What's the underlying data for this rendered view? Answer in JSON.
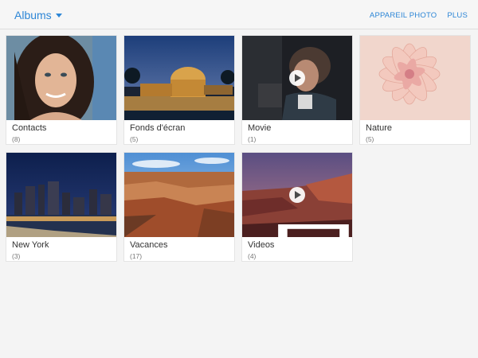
{
  "header": {
    "album_selector_label": "Albums",
    "actions": [
      "APPAREIL PHOTO",
      "PLUS"
    ]
  },
  "albums": [
    {
      "name": "Contacts",
      "count": "(8)",
      "thumb": "portrait-woman",
      "video": false
    },
    {
      "name": "Fonds d'écran",
      "count": "(5)",
      "thumb": "palace-at-night",
      "video": false
    },
    {
      "name": "Movie",
      "count": "(1)",
      "thumb": "movie-still",
      "video": true
    },
    {
      "name": "Nature",
      "count": "(5)",
      "thumb": "pink-dahlia",
      "video": false
    },
    {
      "name": "New York",
      "count": "(3)",
      "thumb": "city-skyline-night",
      "video": false
    },
    {
      "name": "Vacances",
      "count": "(17)",
      "thumb": "grand-canyon",
      "video": false
    },
    {
      "name": "Videos",
      "count": "(4)",
      "thumb": "canyon-dusk",
      "video": true
    }
  ],
  "colors": {
    "accent": "#2d86d6",
    "background": "#f4f4f4"
  }
}
